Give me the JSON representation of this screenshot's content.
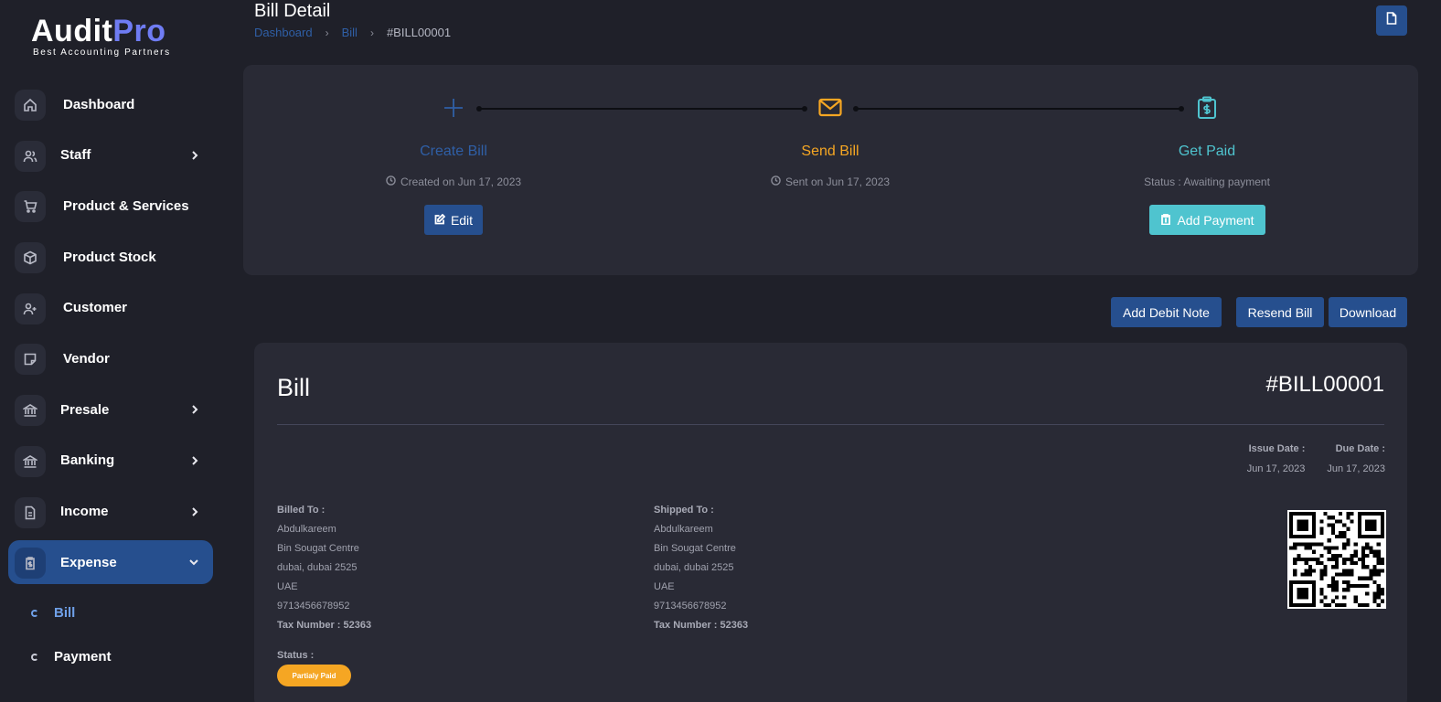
{
  "logo": {
    "main_a": "Audit",
    "main_b": "Pro",
    "tagline": "Best Accounting Partners"
  },
  "sidebar": {
    "items": [
      {
        "label": "Dashboard",
        "icon": "home-icon",
        "expandable": false
      },
      {
        "label": "Staff",
        "icon": "users-icon",
        "expandable": true
      },
      {
        "label": "Product & Services",
        "icon": "cart-icon",
        "expandable": false
      },
      {
        "label": "Product Stock",
        "icon": "box-icon",
        "expandable": false
      },
      {
        "label": "Customer",
        "icon": "user-plus-icon",
        "expandable": false
      },
      {
        "label": "Vendor",
        "icon": "note-icon",
        "expandable": false
      },
      {
        "label": "Presale",
        "icon": "bank-icon",
        "expandable": true
      },
      {
        "label": "Banking",
        "icon": "bank-icon",
        "expandable": true
      },
      {
        "label": "Income",
        "icon": "file-icon",
        "expandable": true
      },
      {
        "label": "Expense",
        "icon": "clipboard-icon",
        "expandable": true,
        "active": true
      }
    ],
    "sub_items": [
      {
        "label": "Bill",
        "active": true
      },
      {
        "label": "Payment",
        "active": false
      }
    ]
  },
  "header": {
    "title": "Bill Detail",
    "breadcrumb": [
      "Dashboard",
      "Bill",
      "#BILL00001"
    ]
  },
  "progress": {
    "steps": [
      {
        "title": "Create Bill",
        "desc": "Created on Jun 17, 2023",
        "button": "Edit",
        "color": "#2f5fa6"
      },
      {
        "title": "Send Bill",
        "desc": "Sent on Jun 17, 2023",
        "color": "#f5a623"
      },
      {
        "title": "Get Paid",
        "desc": "Status : Awaiting payment",
        "button": "Add Payment",
        "color": "#4fc4cf"
      }
    ]
  },
  "actions": {
    "debit_note": "Add Debit Note",
    "resend": "Resend Bill",
    "download": "Download"
  },
  "bill": {
    "title": "Bill",
    "number": "#BILL00001",
    "issue_date_label": "Issue Date :",
    "issue_date": "Jun 17, 2023",
    "due_date_label": "Due Date :",
    "due_date": "Jun 17, 2023",
    "billed_to": {
      "heading": "Billed To :",
      "lines": [
        "Abdulkareem",
        "Bin Sougat Centre",
        "dubai, dubai 2525",
        "UAE",
        "9713456678952"
      ],
      "tax": "Tax Number : 52363"
    },
    "shipped_to": {
      "heading": "Shipped To :",
      "lines": [
        "Abdulkareem",
        "Bin Sougat Centre",
        "dubai, dubai 2525",
        "UAE",
        "9713456678952"
      ],
      "tax": "Tax Number : 52363"
    },
    "status_label": "Status :",
    "status": "Partialy Paid",
    "status_color": "#f5a623"
  }
}
